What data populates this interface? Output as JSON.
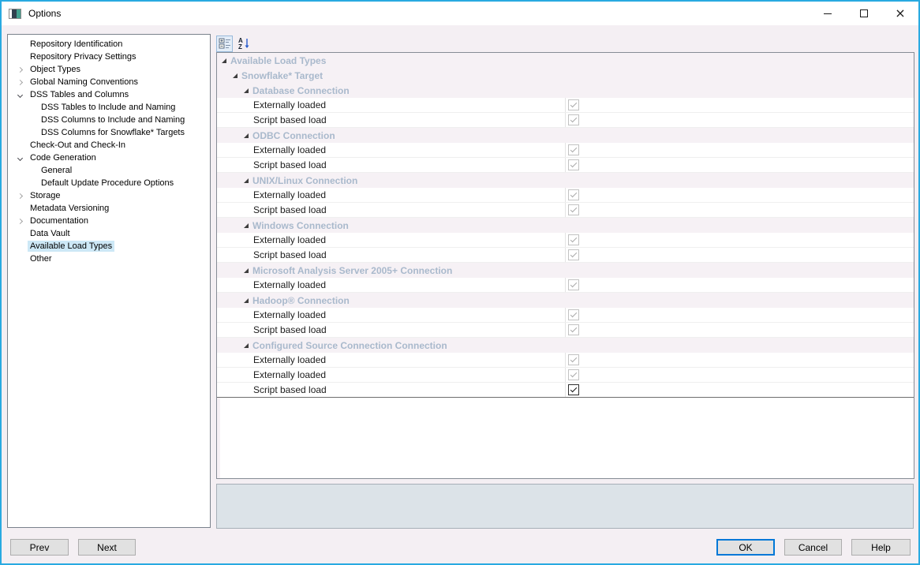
{
  "window": {
    "title": "Options",
    "close_glyph": "×"
  },
  "colors": {
    "window_border": "#29aae1",
    "tree_selection": "#cde8f6",
    "category_text": "#a9b9cc",
    "category_row_bg": "#f6f1f5",
    "ok_button_border": "#0078d7",
    "description_panel_bg": "#dce3e8"
  },
  "sidebar": {
    "items": [
      {
        "label": "Repository Identification",
        "level": 0,
        "expander": null,
        "selected": false
      },
      {
        "label": "Repository Privacy Settings",
        "level": 0,
        "expander": null,
        "selected": false
      },
      {
        "label": "Object Types",
        "level": 0,
        "expander": "collapsed",
        "selected": false
      },
      {
        "label": "Global Naming Conventions",
        "level": 0,
        "expander": "collapsed",
        "selected": false
      },
      {
        "label": "DSS Tables and Columns",
        "level": 0,
        "expander": "expanded",
        "selected": false
      },
      {
        "label": "DSS Tables to Include and Naming",
        "level": 1,
        "expander": null,
        "selected": false
      },
      {
        "label": "DSS Columns to Include and Naming",
        "level": 1,
        "expander": null,
        "selected": false
      },
      {
        "label": "DSS Columns for Snowflake* Targets",
        "level": 1,
        "expander": null,
        "selected": false
      },
      {
        "label": "Check-Out and Check-In",
        "level": 0,
        "expander": null,
        "selected": false
      },
      {
        "label": "Code Generation",
        "level": 0,
        "expander": "expanded",
        "selected": false
      },
      {
        "label": "General",
        "level": 1,
        "expander": null,
        "selected": false
      },
      {
        "label": "Default Update Procedure Options",
        "level": 1,
        "expander": null,
        "selected": false
      },
      {
        "label": "Storage",
        "level": 0,
        "expander": "collapsed",
        "selected": false
      },
      {
        "label": "Metadata Versioning",
        "level": 0,
        "expander": null,
        "selected": false
      },
      {
        "label": "Documentation",
        "level": 0,
        "expander": "collapsed",
        "selected": false
      },
      {
        "label": "Data Vault",
        "level": 0,
        "expander": null,
        "selected": false
      },
      {
        "label": "Available Load Types",
        "level": 0,
        "expander": null,
        "selected": true
      },
      {
        "label": "Other",
        "level": 0,
        "expander": null,
        "selected": false
      }
    ]
  },
  "toolbar": {
    "buttons": [
      {
        "name": "categorized",
        "selected": true
      },
      {
        "name": "alphabetical-sort",
        "selected": false
      }
    ]
  },
  "property_grid": {
    "rows": [
      {
        "type": "category",
        "level": 0,
        "label": "Available Load Types"
      },
      {
        "type": "category",
        "level": 1,
        "label": "Snowflake* Target"
      },
      {
        "type": "category",
        "level": 2,
        "label": "Database Connection"
      },
      {
        "type": "property",
        "label": "Externally loaded",
        "checked": true,
        "enabled": false,
        "active": false
      },
      {
        "type": "property",
        "label": "Script based load",
        "checked": true,
        "enabled": false,
        "active": false
      },
      {
        "type": "category",
        "level": 2,
        "label": "ODBC Connection"
      },
      {
        "type": "property",
        "label": "Externally loaded",
        "checked": true,
        "enabled": false,
        "active": false
      },
      {
        "type": "property",
        "label": "Script based load",
        "checked": true,
        "enabled": false,
        "active": false
      },
      {
        "type": "category",
        "level": 2,
        "label": "UNIX/Linux Connection"
      },
      {
        "type": "property",
        "label": "Externally loaded",
        "checked": true,
        "enabled": false,
        "active": false
      },
      {
        "type": "property",
        "label": "Script based load",
        "checked": true,
        "enabled": false,
        "active": false
      },
      {
        "type": "category",
        "level": 2,
        "label": "Windows Connection"
      },
      {
        "type": "property",
        "label": "Externally loaded",
        "checked": true,
        "enabled": false,
        "active": false
      },
      {
        "type": "property",
        "label": "Script based load",
        "checked": true,
        "enabled": false,
        "active": false
      },
      {
        "type": "category",
        "level": 2,
        "label": "Microsoft Analysis Server 2005+ Connection"
      },
      {
        "type": "property",
        "label": "Externally loaded",
        "checked": true,
        "enabled": false,
        "active": false
      },
      {
        "type": "category",
        "level": 2,
        "label": "Hadoop® Connection"
      },
      {
        "type": "property",
        "label": "Externally loaded",
        "checked": true,
        "enabled": false,
        "active": false
      },
      {
        "type": "property",
        "label": "Script based load",
        "checked": true,
        "enabled": false,
        "active": false
      },
      {
        "type": "category",
        "level": 2,
        "label": "Configured Source Connection Connection"
      },
      {
        "type": "property",
        "label": "Externally loaded",
        "checked": true,
        "enabled": false,
        "active": false
      },
      {
        "type": "property",
        "label": "Externally loaded",
        "checked": true,
        "enabled": false,
        "active": false
      },
      {
        "type": "property",
        "label": "Script based load",
        "checked": true,
        "enabled": true,
        "active": true
      }
    ]
  },
  "description_panel": {
    "text": ""
  },
  "footer": {
    "prev_label": "Prev",
    "next_label": "Next",
    "ok_label": "OK",
    "cancel_label": "Cancel",
    "help_label": "Help"
  }
}
